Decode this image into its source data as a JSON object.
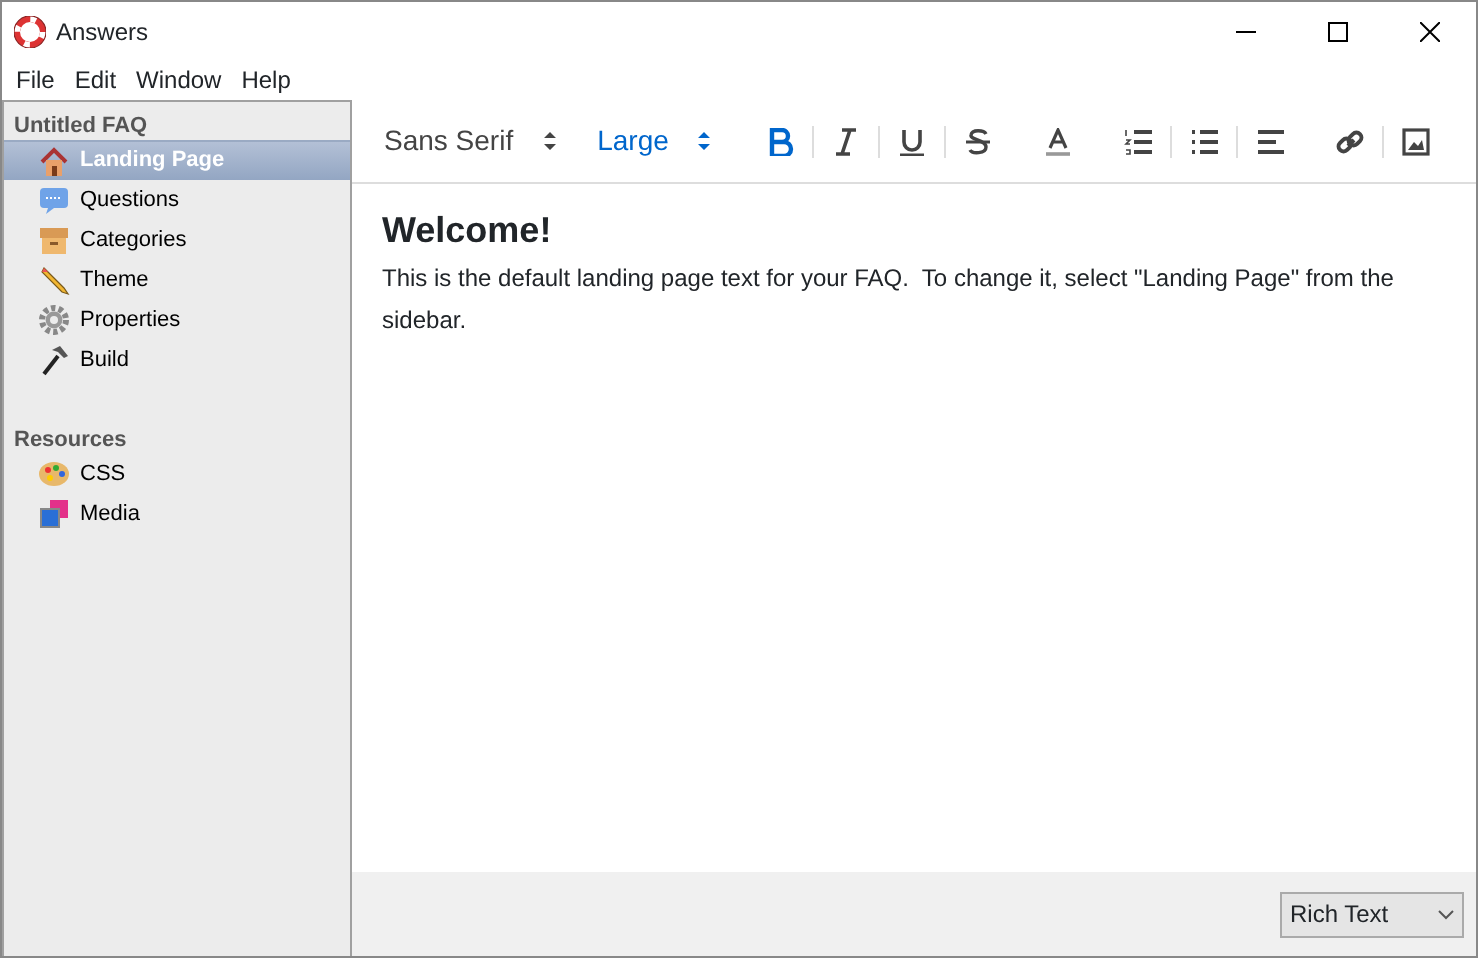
{
  "window": {
    "title": "Answers"
  },
  "menu": [
    "File",
    "Edit",
    "Window",
    "Help"
  ],
  "sidebar": {
    "sections": [
      {
        "title": "Untitled FAQ",
        "items": [
          {
            "label": "Landing Page",
            "selected": true
          },
          {
            "label": "Questions",
            "selected": false
          },
          {
            "label": "Categories",
            "selected": false
          },
          {
            "label": "Theme",
            "selected": false
          },
          {
            "label": "Properties",
            "selected": false
          },
          {
            "label": "Build",
            "selected": false
          }
        ]
      },
      {
        "title": "Resources",
        "items": [
          {
            "label": "CSS",
            "selected": false
          },
          {
            "label": "Media",
            "selected": false
          }
        ]
      }
    ]
  },
  "toolbar": {
    "font": {
      "value": "Sans Serif",
      "active": false
    },
    "size": {
      "value": "Large",
      "active": true
    },
    "groups": [
      [
        {
          "kind": "bold",
          "active": true
        }
      ],
      [
        {
          "kind": "italic",
          "active": false
        }
      ],
      [
        {
          "kind": "underline",
          "active": false
        }
      ],
      [
        {
          "kind": "strike",
          "active": false
        },
        {
          "kind": "color",
          "active": false
        },
        {
          "kind": "ordered",
          "active": false
        }
      ],
      [
        {
          "kind": "bullet",
          "active": false
        }
      ],
      [
        {
          "kind": "align",
          "active": false
        },
        {
          "kind": "link",
          "active": false
        }
      ],
      [
        {
          "kind": "image",
          "active": false
        }
      ]
    ]
  },
  "editor": {
    "heading": "Welcome!",
    "paragraph": "This is the default landing page text for your FAQ.  To change it, select \"Landing Page\" from the sidebar."
  },
  "format_select": {
    "value": "Rich Text"
  }
}
